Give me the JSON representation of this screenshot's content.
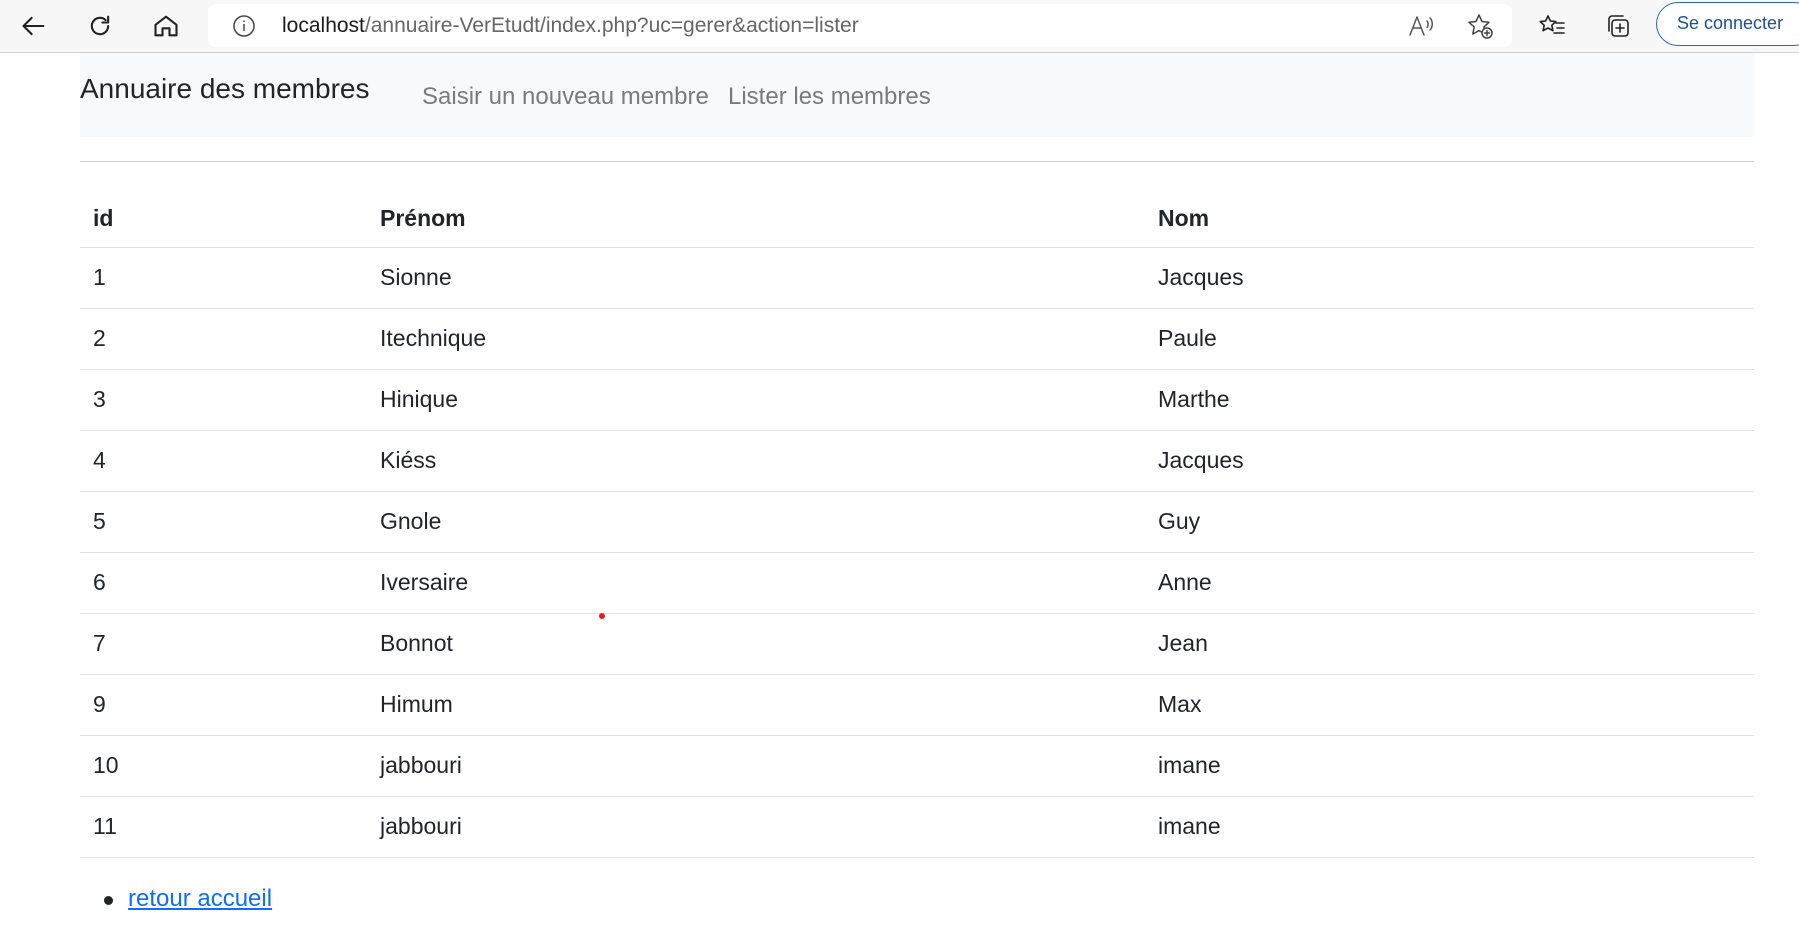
{
  "browser": {
    "url_host": "localhost",
    "url_path": "/annuaire-VerEtudt/index.php?uc=gerer&action=lister",
    "signin_label": "Se connecter",
    "icons": [
      "back-arrow-icon",
      "refresh-icon",
      "home-icon",
      "info-icon",
      "read-aloud-icon",
      "add-favorite-icon",
      "favorites-icon",
      "collections-icon"
    ]
  },
  "navbar": {
    "brand": "Annuaire des membres",
    "links": [
      "Saisir un nouveau membre",
      "Lister les membres"
    ]
  },
  "table": {
    "headers": [
      "id",
      "Prénom",
      "Nom"
    ],
    "rows": [
      [
        "1",
        "Sionne",
        "Jacques"
      ],
      [
        "2",
        "Itechnique",
        "Paule"
      ],
      [
        "3",
        "Hinique",
        "Marthe"
      ],
      [
        "4",
        "Kiéss",
        "Jacques"
      ],
      [
        "5",
        "Gnole",
        "Guy"
      ],
      [
        "6",
        "Iversaire",
        "Anne"
      ],
      [
        "7",
        "Bonnot",
        "Jean"
      ],
      [
        "9",
        "Himum",
        "Max"
      ],
      [
        "10",
        "jabbouri",
        "imane"
      ],
      [
        "11",
        "jabbouri",
        "imane"
      ]
    ]
  },
  "footer_links": [
    "retour accueil"
  ],
  "colors": {
    "navbar_bg": "#f8f9fa",
    "link": "#0d6efd",
    "signin_border": "#2a66b8"
  }
}
